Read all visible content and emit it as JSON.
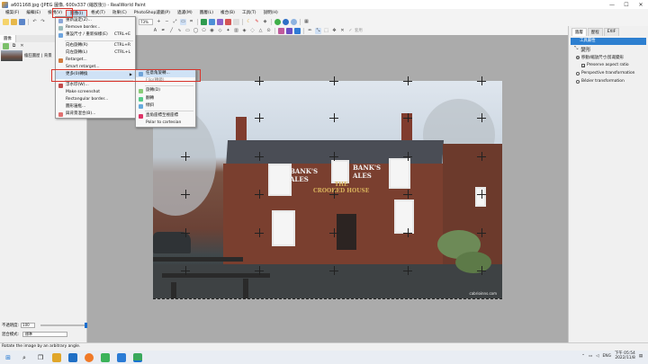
{
  "window": {
    "title": "a601168.jpg (JPEG 圖像, 600x337 (縮放後)) - RealWorld Paint",
    "controls": [
      "—",
      "☐",
      "✕"
    ]
  },
  "menubar": [
    "檔案(F)",
    "編輯(E)",
    "檢視(V)",
    "圖像(I)",
    "格式(T)",
    "效果(C)",
    "PhotoShop濾鏡(P)",
    "過濾(M)",
    "圖層(L)",
    "複合(B)",
    "工具(T)",
    "說明(H)"
  ],
  "toolbar": {
    "zoom": "73%",
    "apply_label": "套用"
  },
  "left_panel": {
    "tab": "圖像",
    "thumbnail_label": "瘋狂圖屋 | 背景",
    "opacity_label": "不透明度:",
    "opacity_value": "100",
    "blend_label": "混合模式:",
    "blend_value": "標準"
  },
  "image_menu": {
    "items": [
      {
        "label": "重新設定(Z)...",
        "shortcut": ""
      },
      {
        "label": "Remove border...",
        "shortcut": ""
      },
      {
        "label": "重設尺寸 / 重新採樣(E)",
        "shortcut": "CTRL+E"
      },
      {
        "sep": true
      },
      {
        "label": "向右旋轉(R)",
        "shortcut": "CTRL+R"
      },
      {
        "label": "向左旋轉(L)",
        "shortcut": "CTRL+L"
      },
      {
        "label": "Retarget...",
        "shortcut": ""
      },
      {
        "label": "Smart retarget...",
        "shortcut": ""
      },
      {
        "label": "更多(0)轉換",
        "shortcut": "",
        "submenu": true,
        "highlighted": true
      },
      {
        "sep": true
      },
      {
        "label": "浮水印(W)...",
        "shortcut": ""
      },
      {
        "label": "Make screenshot",
        "shortcut": ""
      },
      {
        "label": "Rectangular border...",
        "shortcut": ""
      },
      {
        "label": "圖形邊框...",
        "shortcut": ""
      },
      {
        "label": "與背景混合(B)...",
        "shortcut": ""
      }
    ]
  },
  "transform_submenu": {
    "items": [
      {
        "label": "任意角旋轉...",
        "highlighted": true
      },
      {
        "label": "Flip(轉鏡)",
        "disabled": true
      },
      {
        "sep": true
      },
      {
        "label": "旋轉(D)"
      },
      {
        "label": "翻轉"
      },
      {
        "label": "傾斜"
      },
      {
        "sep": true
      },
      {
        "label": "直角座標至極座標"
      },
      {
        "label": "Polar to cartesian"
      }
    ]
  },
  "right_panel": {
    "tabs": [
      "圖層",
      "歷程",
      "EXIF"
    ],
    "header": "工具屬性",
    "section_title": "變形",
    "options": [
      {
        "label": "移動/縮放尺寸/剪裁變形",
        "selected": true
      },
      {
        "label": "Preserve aspect ratio",
        "checkbox": true,
        "checked": true
      },
      {
        "label": "Perspective transformation",
        "selected": false
      },
      {
        "label": "Bézier transformation",
        "selected": false
      }
    ]
  },
  "photo": {
    "sign_left": "BANK'S\nALES",
    "sign_right": "BANK'S\nALES",
    "sign_center": "THE\nCROOKED HOUSE",
    "watermark": "cabrioinns.com"
  },
  "statusbar": {
    "text": "Rotate the image by an arbitrary angle."
  },
  "taskbar": {
    "language": "ENG",
    "time": "下午 05:54",
    "date": "2022/11/8"
  }
}
